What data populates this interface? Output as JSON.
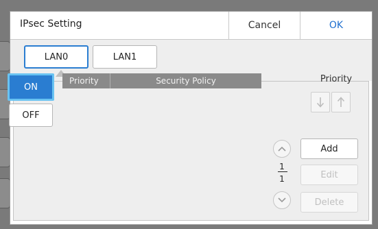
{
  "dialog": {
    "title": "IPsec Setting",
    "cancel_label": "Cancel",
    "ok_label": "OK"
  },
  "lan_tabs": [
    {
      "label": "LAN0",
      "selected": true
    },
    {
      "label": "LAN1",
      "selected": false
    }
  ],
  "toggle": {
    "on_label": "ON",
    "off_label": "OFF",
    "selected": "ON"
  },
  "table": {
    "columns": [
      "Priority",
      "Security Policy"
    ],
    "rows": []
  },
  "priority": {
    "label": "Priority",
    "down_icon": "arrow-down-icon",
    "up_icon": "arrow-up-icon"
  },
  "pagination": {
    "current": "1",
    "total": "1"
  },
  "actions": {
    "add_label": "Add",
    "edit_label": "Edit",
    "delete_label": "Delete"
  },
  "colors": {
    "accent": "#2a7dd1",
    "ok_text": "#1f6fcf",
    "header_bg": "#8a8a8a"
  }
}
